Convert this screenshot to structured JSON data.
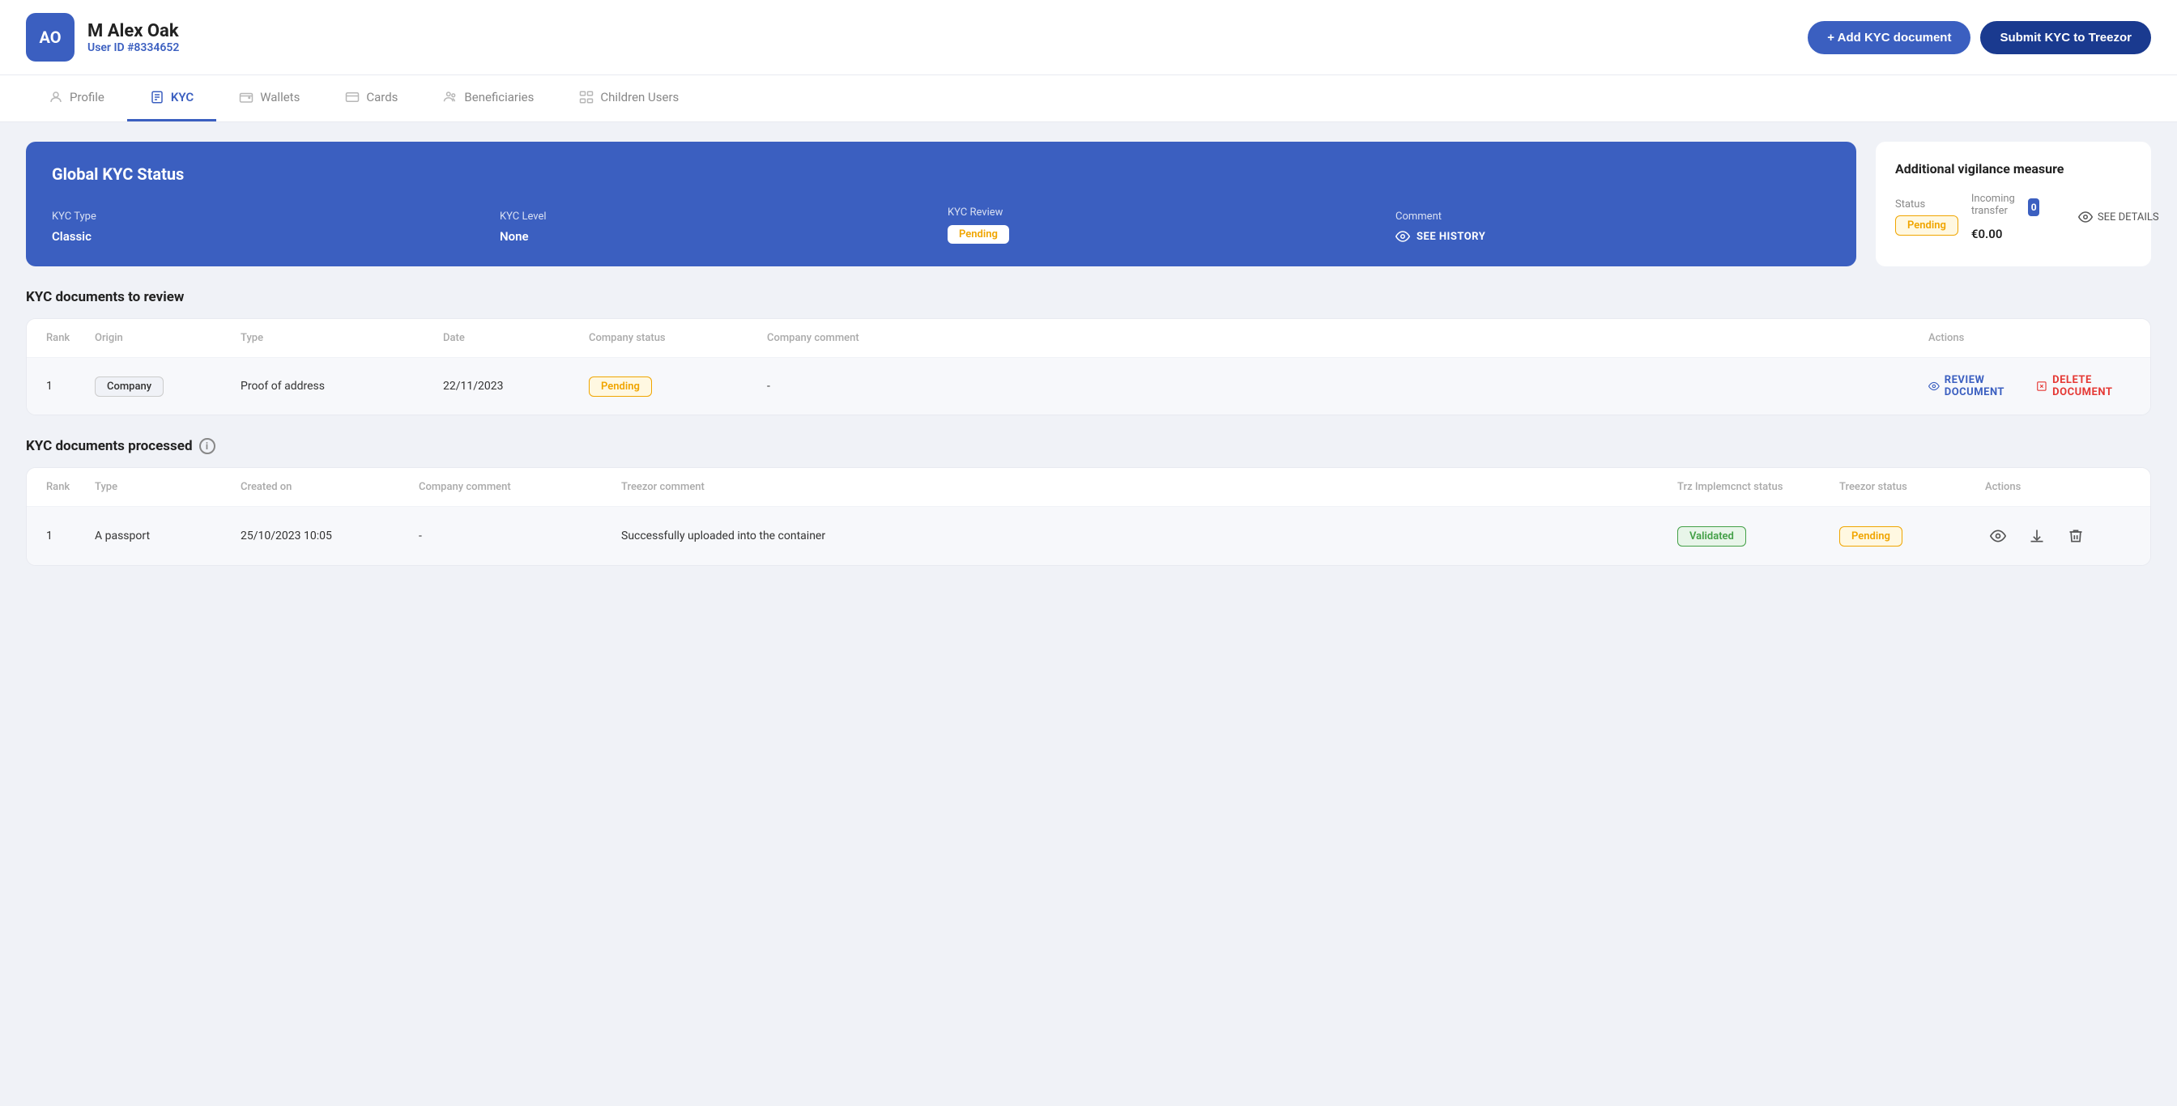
{
  "header": {
    "avatar_initials": "AO",
    "user_name": "M Alex Oak",
    "user_id_label": "User ID #8334652",
    "btn_add_kyc": "+ Add KYC document",
    "btn_submit_kyc": "Submit KYC to Treezor"
  },
  "nav": {
    "tabs": [
      {
        "id": "profile",
        "label": "Profile",
        "active": false
      },
      {
        "id": "kyc",
        "label": "KYC",
        "active": true
      },
      {
        "id": "wallets",
        "label": "Wallets",
        "active": false
      },
      {
        "id": "cards",
        "label": "Cards",
        "active": false
      },
      {
        "id": "beneficiaries",
        "label": "Beneficiaries",
        "active": false
      },
      {
        "id": "children-users",
        "label": "Children Users",
        "active": false
      }
    ]
  },
  "kyc_status": {
    "card_title": "Global KYC Status",
    "kyc_type_label": "KYC Type",
    "kyc_type_value": "Classic",
    "kyc_level_label": "KYC Level",
    "kyc_level_value": "None",
    "kyc_review_label": "KYC Review",
    "kyc_review_badge": "Pending",
    "comment_label": "Comment",
    "see_history": "SEE HISTORY"
  },
  "vigilance": {
    "title": "Additional vigilance measure",
    "status_label": "Status",
    "status_badge": "Pending",
    "incoming_transfer_label": "Incoming transfer",
    "incoming_transfer_count": "0",
    "transfer_amount": "€0.00",
    "see_details": "SEE DETAILS"
  },
  "review_section": {
    "title": "KYC documents to review",
    "columns": [
      "Rank",
      "Origin",
      "Type",
      "Date",
      "Company status",
      "Company comment",
      "Actions"
    ],
    "rows": [
      {
        "rank": "1",
        "origin": "Company",
        "type": "Proof of address",
        "date": "22/11/2023",
        "company_status": "Pending",
        "company_comment": "-",
        "action_review": "REVIEW DOCUMENT",
        "action_delete": "DELETE DOCUMENT"
      }
    ]
  },
  "processed_section": {
    "title": "KYC documents processed",
    "has_info": true,
    "columns": [
      "Rank",
      "Type",
      "Created on",
      "Company comment",
      "Treezor comment",
      "Trz Implemcnct status",
      "Treezor status",
      "Actions"
    ],
    "rows": [
      {
        "rank": "1",
        "type": "A passport",
        "created_on": "25/10/2023 10:05",
        "company_comment": "-",
        "treezor_comment": "Successfully uploaded into the container",
        "trz_status": "Validated",
        "treezor_status": "Pending"
      }
    ]
  }
}
